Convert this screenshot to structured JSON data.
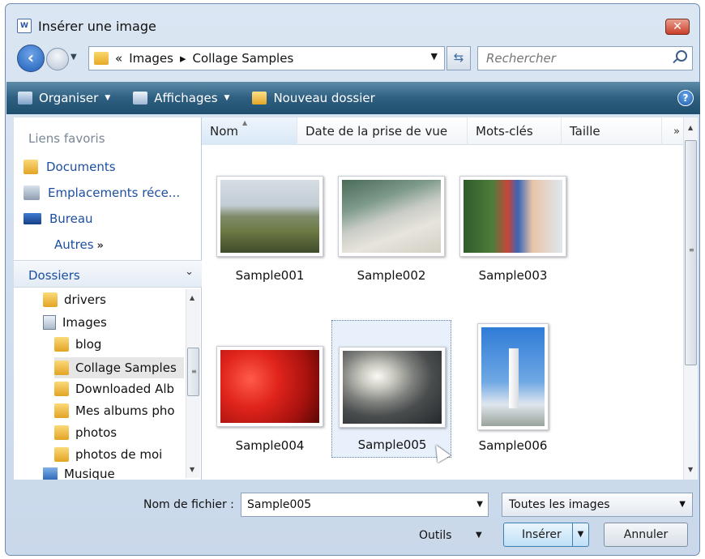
{
  "window": {
    "title": "Insérer une image",
    "close_label": "✕"
  },
  "nav": {
    "crumbs": [
      "«",
      "Images",
      "▸",
      "Collage Samples"
    ],
    "search_placeholder": "Rechercher"
  },
  "toolbar": {
    "organize": "Organiser",
    "views": "Affichages",
    "new_folder": "Nouveau dossier",
    "help": "?"
  },
  "favorites": {
    "heading": "Liens favoris",
    "items": [
      "Documents",
      "Emplacements réce...",
      "Bureau"
    ],
    "more": "Autres",
    "more_chevron": "»"
  },
  "folders": {
    "heading": "Dossiers",
    "chevron": "⌄",
    "tree": [
      "drivers",
      "Images",
      "blog",
      "Collage Samples",
      "Downloaded Alb",
      "Mes albums pho",
      "photos",
      "photos de moi",
      "Musique"
    ],
    "selected": "Collage Samples"
  },
  "columns": {
    "name": "Nom",
    "date": "Date de la prise de vue",
    "tags": "Mots-clés",
    "size": "Taille",
    "more": "»"
  },
  "thumbnails": [
    {
      "label": "Sample001",
      "scene": "coast-field"
    },
    {
      "label": "Sample002",
      "scene": "beach-sand"
    },
    {
      "label": "Sample003",
      "scene": "child-parrot"
    },
    {
      "label": "Sample004",
      "scene": "red-flowers"
    },
    {
      "label": "Sample005",
      "scene": "sunset-sea",
      "selected": true
    },
    {
      "label": "Sample006",
      "scene": "lighthouse"
    }
  ],
  "footer": {
    "filename_label": "Nom de fichier :",
    "filename_value": "Sample005",
    "filter_value": "Toutes les images",
    "tools": "Outils",
    "insert": "Insérer",
    "cancel": "Annuler"
  }
}
